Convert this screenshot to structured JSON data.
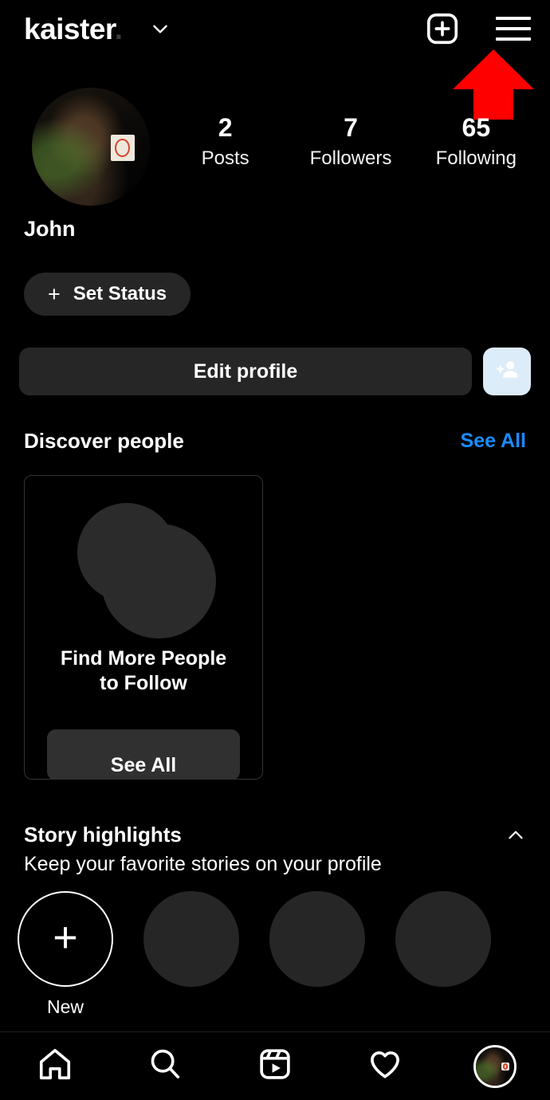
{
  "colors": {
    "background": "#000000",
    "surface": "#262626",
    "link_blue": "#1a8cff",
    "accent_light_blue": "#dcecf9",
    "annotation_red": "#ff0000",
    "text_primary": "#ffffff"
  },
  "topbar": {
    "username": "kaister",
    "username_trailing": ".",
    "chevron_icon": "chevron-down-icon",
    "create_icon": "plus-square-icon",
    "menu_icon": "hamburger-menu-icon"
  },
  "annotation": {
    "arrow_icon": "red-up-arrow",
    "points_at": "hamburger-menu-icon"
  },
  "profile": {
    "avatar_alt": "profile-photo",
    "display_name": "John",
    "stats": [
      {
        "value": "2",
        "label": "Posts"
      },
      {
        "value": "7",
        "label": "Followers"
      },
      {
        "value": "65",
        "label": "Following"
      }
    ],
    "status_button": {
      "plus": "+",
      "label": "Set Status"
    },
    "edit_profile_label": "Edit profile",
    "add_user_icon": "person-add-icon"
  },
  "discover": {
    "title": "Discover people",
    "see_all_label": "See All",
    "card": {
      "title": "Find More People\nto Follow",
      "title_line1": "Find More People",
      "title_line2": "to Follow",
      "button_label": "See All",
      "illustration_icon": "two-circles-avatars"
    }
  },
  "highlights": {
    "title": "Story highlights",
    "subtitle": "Keep your favorite stories on your profile",
    "collapse_icon": "chevron-up-icon",
    "new_button": {
      "plus": "+",
      "label": "New"
    },
    "placeholder_count": 3
  },
  "bottom_nav": {
    "items": [
      {
        "icon": "home-icon",
        "active": false
      },
      {
        "icon": "search-icon",
        "active": false
      },
      {
        "icon": "reels-icon",
        "active": false
      },
      {
        "icon": "heart-icon",
        "active": false
      },
      {
        "icon": "profile-avatar-icon",
        "active": true
      }
    ]
  }
}
